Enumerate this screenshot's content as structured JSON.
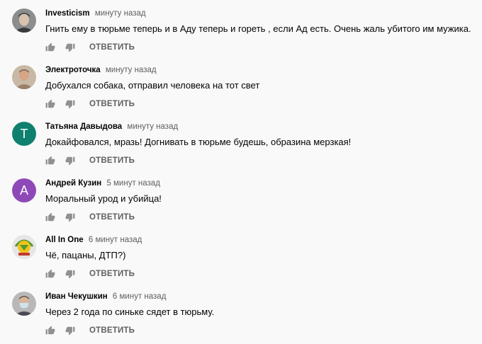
{
  "colors": {
    "background": "#f9f9f9",
    "author": "#030303",
    "meta": "#606060",
    "icon": "#909090"
  },
  "comments": [
    {
      "author": "Investicism",
      "time": "минуту назад",
      "text": "Гнить ему в тюрьме теперь и в Аду теперь и гореть , если Ад есть. Очень жаль убитого им мужика.",
      "reply_label": "ОТВЕТИТЬ",
      "avatar": {
        "type": "photo",
        "icon": "person-photo-icon",
        "colors": [
          "#8b8d8f",
          "#d9c2ad",
          "#3a3a3a"
        ]
      }
    },
    {
      "author": "Электроточка",
      "time": "минуту назад",
      "text": "Добухался собака, отправил человека на тот свет",
      "reply_label": "ОТВЕТИТЬ",
      "avatar": {
        "type": "photo",
        "icon": "person-photo-icon",
        "colors": [
          "#c8b8a6",
          "#d8a585",
          "#9a7f6a"
        ]
      }
    },
    {
      "author": "Татьяна Давыдова",
      "time": "минуту назад",
      "text": "Докайфовался, мразь! Догнивать в тюрьме будешь, образина мерзкая!",
      "reply_label": "ОТВЕТИТЬ",
      "avatar": {
        "type": "letter",
        "letter": "T",
        "color": "#10806e"
      }
    },
    {
      "author": "Андрей Кузин",
      "time": "5 минут назад",
      "text": "Моральный урод и убийца!",
      "reply_label": "ОТВЕТИТЬ",
      "avatar": {
        "type": "letter",
        "letter": "A",
        "color": "#8e49b9"
      }
    },
    {
      "author": "All In One",
      "time": "6 минут назад",
      "text": "Чё, пацаны, ДТП?)",
      "reply_label": "ОТВЕТИТЬ",
      "avatar": {
        "type": "logo",
        "icon": "emblem-logo-icon",
        "colors": [
          "#e6e6e6",
          "#f2c11b",
          "#4e9b2e",
          "#c0392b"
        ]
      }
    },
    {
      "author": "Иван Чекушкин",
      "time": "6 минут назад",
      "text": "Через 2 года по синьке сядет в тюрьму.",
      "reply_label": "ОТВЕТИТЬ",
      "avatar": {
        "type": "photo",
        "icon": "masked-person-photo-icon",
        "colors": [
          "#b8b8b8",
          "#d9b49a",
          "#cfe3ec"
        ]
      }
    }
  ]
}
